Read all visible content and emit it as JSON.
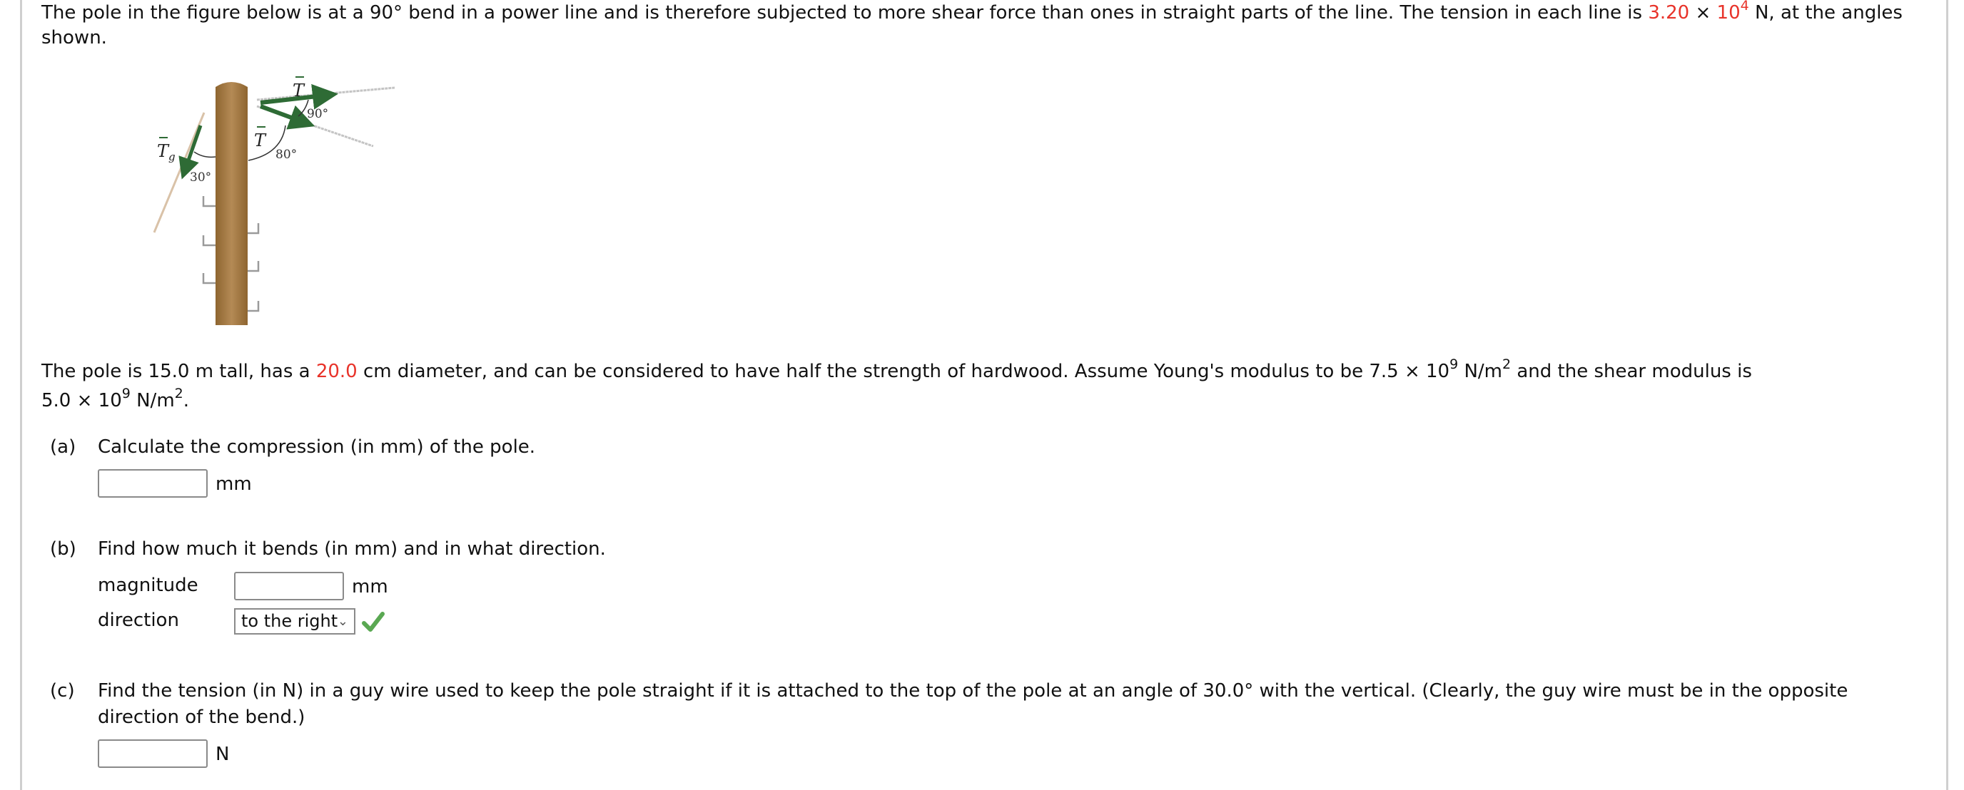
{
  "intro": {
    "line1_a": "The pole in the figure below is at a 90° bend in a power line and is therefore subjected to more shear force than ones in straight parts of the line. The tension in each line is ",
    "tension_mantissa": "3.20",
    "times": "×",
    "tension_base": "10",
    "tension_exp": "4",
    "line1_b": " N, at the angles",
    "line2": "shown."
  },
  "figure": {
    "label_t_top": "T",
    "label_t_mid": "T",
    "label_tg": "T",
    "label_tg_sub": "g",
    "angle_90": "90°",
    "angle_80": "80°",
    "angle_30": "30°",
    "colors": {
      "pole": "#a87b45",
      "arrow": "#2e6b35",
      "wire": "#bbbbbb"
    }
  },
  "given": {
    "line1_a": "The pole is 15.0 m tall, has a ",
    "diameter": "20.0",
    "line1_b": " cm diameter, and can be considered to have half the strength of hardwood. Assume Young's modulus to be 7.5 × 10",
    "young_exp": "9",
    "line1_c": " N/m",
    "young_unit_exp": "2",
    "line1_d": " and the shear modulus is",
    "line2_a": "5.0 × 10",
    "shear_exp": "9",
    "line2_b": " N/m",
    "shear_unit_exp": "2",
    "line2_c": "."
  },
  "part_a": {
    "label": "(a)",
    "question": "Calculate the compression (in mm) of the pole.",
    "value": "",
    "unit": "mm"
  },
  "part_b": {
    "label": "(b)",
    "question": "Find how much it bends (in mm) and in what direction.",
    "magnitude_label": "magnitude",
    "magnitude_value": "",
    "magnitude_unit": "mm",
    "direction_label": "direction",
    "direction_selected": "to the right",
    "direction_status": "correct"
  },
  "part_c": {
    "label": "(c)",
    "question_line1": "Find the tension (in N) in a guy wire used to keep the pole straight if it is attached to the top of the pole at an angle of 30.0° with the vertical. (Clearly, the guy wire must be in the opposite",
    "question_line2": "direction of the bend.)",
    "value": "",
    "unit": "N"
  }
}
